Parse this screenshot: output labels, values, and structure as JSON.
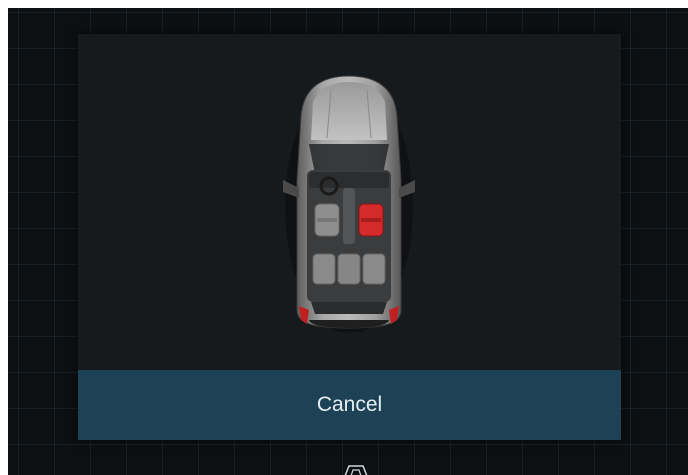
{
  "dialog": {
    "cancel_label": "Cancel"
  },
  "car": {
    "icon": "car-top-view-icon",
    "selected_seat": "front-passenger-seat",
    "selected_color": "#d42a2a",
    "body_color": "#8a8a8a"
  },
  "background": {
    "grid_color": "#2a3a44",
    "bottom_icon": "car-outline-icon"
  }
}
